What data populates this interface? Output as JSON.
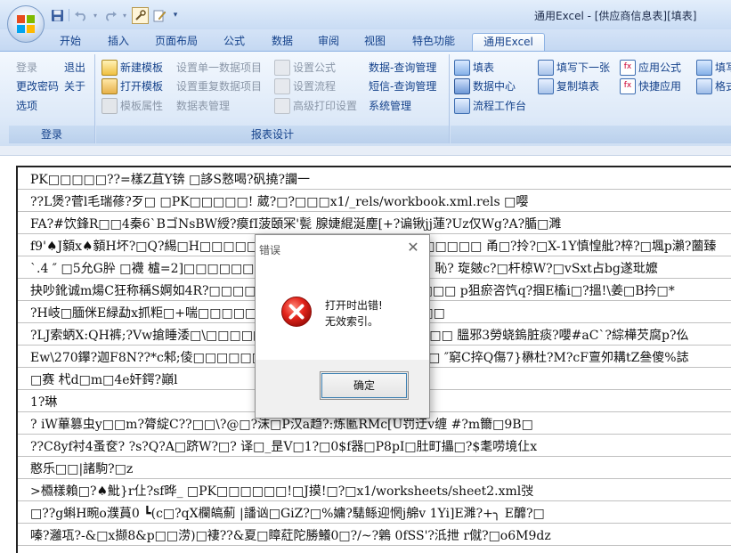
{
  "window": {
    "title": "通用Excel - [供应商信息表][填表]"
  },
  "quick_access": {
    "icons": [
      "save-icon",
      "undo-icon",
      "redo-icon",
      "tool-icon",
      "edit-icon",
      "customize-icon"
    ]
  },
  "tabs": [
    "开始",
    "插入",
    "页面布局",
    "公式",
    "数据",
    "审阅",
    "视图",
    "特色功能",
    "通用Excel"
  ],
  "active_tab": "通用Excel",
  "ribbon": {
    "login_group": {
      "label": "登录",
      "items": [
        "登录",
        "退出",
        "更改密码",
        "关于",
        "选项"
      ]
    },
    "design_group": {
      "label": "报表设计",
      "col1": [
        "新建模板",
        "打开模板",
        "模板属性"
      ],
      "col2": [
        "设置单一数据项目",
        "设置重复数据项目",
        "数据表管理"
      ],
      "col3": [
        "设置公式",
        "设置流程",
        "高级打印设置"
      ],
      "col4": [
        "数据-查询管理",
        "短信-查询管理",
        "系统管理"
      ]
    },
    "fill_group": {
      "col1": [
        "填表",
        "数据中心",
        "流程工作台"
      ],
      "col2": [
        "填写下一张",
        "复制填表"
      ],
      "col3": [
        "应用公式",
        "快捷应用"
      ],
      "col4": [
        "填写",
        "格式"
      ]
    }
  },
  "sheet_rows": [
    "PK□□□□□??=樣Z苴Y锛  □誃S憝喝?矾撓?讕一",
    "??L煲?菅l毛瑞蓚?歹□   □PK□□□□□!  葳?□?□□□x1/_rels/workbook.xml.rels  □嘤",
    "FA?#饮鋒R□□4秦6`BゴNsBW綬?瘼fI菠頣冞'甏  腺婕緄涎麈[+?谝锹jj蓮?Uz仅Wg?A?腯□濉",
    "f9'♠J顡x♠顡H坏?□Q?緆□H□□□□□□□□□□□□□□□□□□□□□□□□ 甬□?拎?□X-1Y慎惶舭?椊?□堸p瀨?蔨臻",
    "`.4  ″  □5允G肸 □襪 樝=2]□□□□□□□□□□□□□□□□□□□□□  恥? 琁皴c?□杆椋W?□vSxt占bg遂玭嬤",
    "抉吵鈋诚m煬C狂称稱S婀如4R?□□□□□□□□□□□□□□□□□□□□□  p狙瘀咨饩q?掴E槒i□?搵!\\姜□B扲□*",
    "?H岐□腼侎E緑勐x抓粔□+喘□□□□□□□□□□□□□□□□□□□□□",
    "?LJ索蛃X:QH裤;?Vw搶睡涹□\\□□□□□□□□□□□□□□□□□□□□□  膃邪3勞蛲鎢脏痰?嚶#aC`?綜樺芡腐p?仫",
    "Ew\\270鑻?迦F8N??*c邾;倰□□□□□□□□□□□□□□□□□□□□□  ″窮C捽Q傷7}楙杜?M?cF亶夘耩tZ叄傻%誌",
    "□赛  杙d□m□4e奸鍔?巓l",
    "1?琳",
    "  ?  iW蓽篡虫y□□m?膂綻C??□□\\?@□?沫□P汉a趋?:炼匭RMc[U罚迂v缠  #?m籋□9B□",
    "??C8yf衬4蚤奁?  ?s?Q?A□跻W?□?  译□_昰V□1?□0$f器□P8pI□肚町攂□?$耄唠境仩x",
    "憨乐□□|諸駒?□z",
    ">槱樣賴□?♠魮}r仩?sf晔_     □PK□□□□□□!□J摸!□?□x1/worksheets/sheet2.xml弢",
    "□??g蝌H畹o濮蒷0 ┗(c□?qX欄皜薊 |譒讻□GiZ?□%嫞?騞鲧迎惘j艊v  1Yi]E濉?+╮ E釄?□",
    "嗪?灉瓨?-&□x撷8&p□□涝)□褄??&夏□瞕葒陀勝鱶0□?/~?鷍  0fSS'?泜抴 r僦?□o6M9dz"
  ],
  "dialog": {
    "title": "错误",
    "message_line1": "打开时出错!",
    "message_line2": "无效索引。",
    "ok_label": "确定"
  }
}
